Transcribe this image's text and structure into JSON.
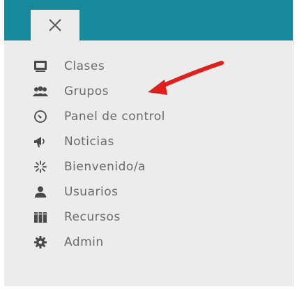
{
  "close_button": {
    "label": "✕",
    "icon": "close-icon"
  },
  "menu": {
    "items": [
      {
        "label": "Clases",
        "icon": "classroom-icon"
      },
      {
        "label": "Grupos",
        "icon": "group-icon"
      },
      {
        "label": "Panel de control",
        "icon": "dashboard-icon"
      },
      {
        "label": "Noticias",
        "icon": "megaphone-icon"
      },
      {
        "label": "Bienvenido/a",
        "icon": "sparkle-icon"
      },
      {
        "label": "Usuarios",
        "icon": "user-icon"
      },
      {
        "label": "Recursos",
        "icon": "books-icon"
      },
      {
        "label": "Admin",
        "icon": "gear-icon"
      }
    ]
  },
  "colors": {
    "topbar": "#168a9c",
    "panel": "#ececec",
    "text": "#6b6b6b",
    "icon": "#4a4a4a",
    "annotation_arrow": "#e0201b"
  }
}
